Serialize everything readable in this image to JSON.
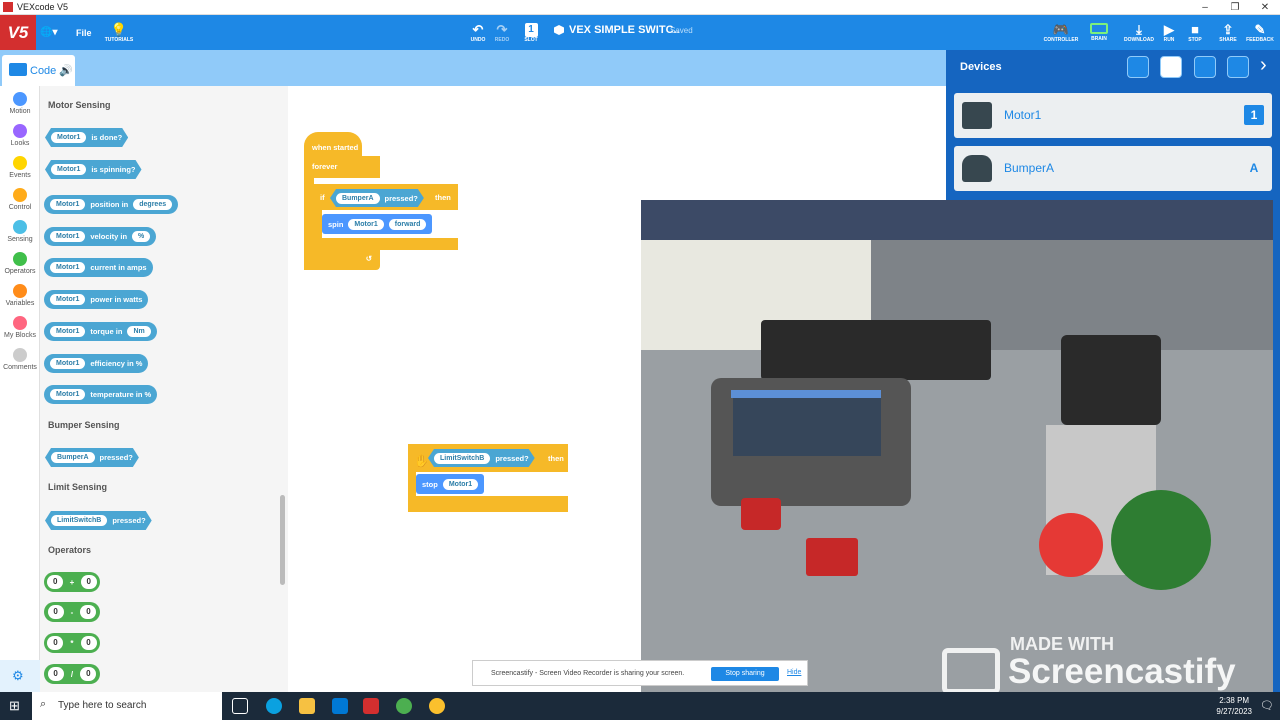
{
  "window": {
    "title": "VEXcode V5",
    "min": "–",
    "max": "❐",
    "close": "✕"
  },
  "toolbar": {
    "logo": "V5",
    "file": "File",
    "tutorials": "TUTORIALS",
    "undo": "UNDO",
    "redo": "REDO",
    "slot": "SLOT",
    "slot_num": "1",
    "project_name": "VEX SIMPLE SWITC..",
    "saved": "Saved",
    "controller": "CONTROLLER",
    "brain": "BRAIN",
    "download": "DOWNLOAD",
    "run": "RUN",
    "stop": "STOP",
    "share": "SHARE",
    "feedback": "FEEDBACK"
  },
  "code_tab": {
    "label": "Code"
  },
  "categories": [
    {
      "label": "Motion",
      "color": "#4c97ff"
    },
    {
      "label": "Looks",
      "color": "#9966ff"
    },
    {
      "label": "Events",
      "color": "#ffd500"
    },
    {
      "label": "Control",
      "color": "#ffab19"
    },
    {
      "label": "Sensing",
      "color": "#4cbfe6"
    },
    {
      "label": "Operators",
      "color": "#40bf4a"
    },
    {
      "label": "Variables",
      "color": "#ff8c1a"
    },
    {
      "label": "My Blocks",
      "color": "#ff6680"
    },
    {
      "label": "Comments",
      "color": "#cccccc"
    }
  ],
  "palette": {
    "motor_sensing": "Motor Sensing",
    "bumper_sensing": "Bumper Sensing",
    "limit_sensing": "Limit Sensing",
    "operators": "Operators",
    "motor": "Motor1",
    "is_done": "is done?",
    "is_spinning": "is spinning?",
    "position_in": "position in",
    "degrees": "degrees",
    "velocity_in": "velocity in",
    "percent": "%",
    "current_in_amps": "current in amps",
    "power_in_watts": "power in watts",
    "torque_in": "torque in",
    "nm": "Nm",
    "efficiency_in": "efficiency in %",
    "temperature_in": "temperature in %",
    "bumper": "BumperA",
    "pressed": "pressed?",
    "limit": "LimitSwitchB",
    "ops": [
      {
        "a": "0",
        "op": "+",
        "b": "0"
      },
      {
        "a": "0",
        "op": "-",
        "b": "0"
      },
      {
        "a": "0",
        "op": "*",
        "b": "0"
      },
      {
        "a": "0",
        "op": "/",
        "b": "0"
      }
    ]
  },
  "workspace": {
    "when_started": "when started",
    "forever": "forever",
    "if": "if",
    "then": "then",
    "spin": "spin",
    "forward": "forward",
    "stop": "stop",
    "bumper": "BumperA",
    "limit": "LimitSwitchB",
    "pressed": "pressed?",
    "motor": "Motor1"
  },
  "devices": {
    "title": "Devices",
    "items": [
      {
        "name": "Motor1",
        "port": "1"
      },
      {
        "name": "BumperA",
        "port": "A"
      }
    ]
  },
  "toast": {
    "text": "Screencastify - Screen Video Recorder is sharing your screen.",
    "stop": "Stop sharing",
    "hide": "Hide"
  },
  "watermark": {
    "made_with": "MADE WITH",
    "brand": "Screencastify"
  },
  "taskbar": {
    "search_placeholder": "Type here to search",
    "time": "2:38 PM",
    "date": "9/27/2023"
  }
}
